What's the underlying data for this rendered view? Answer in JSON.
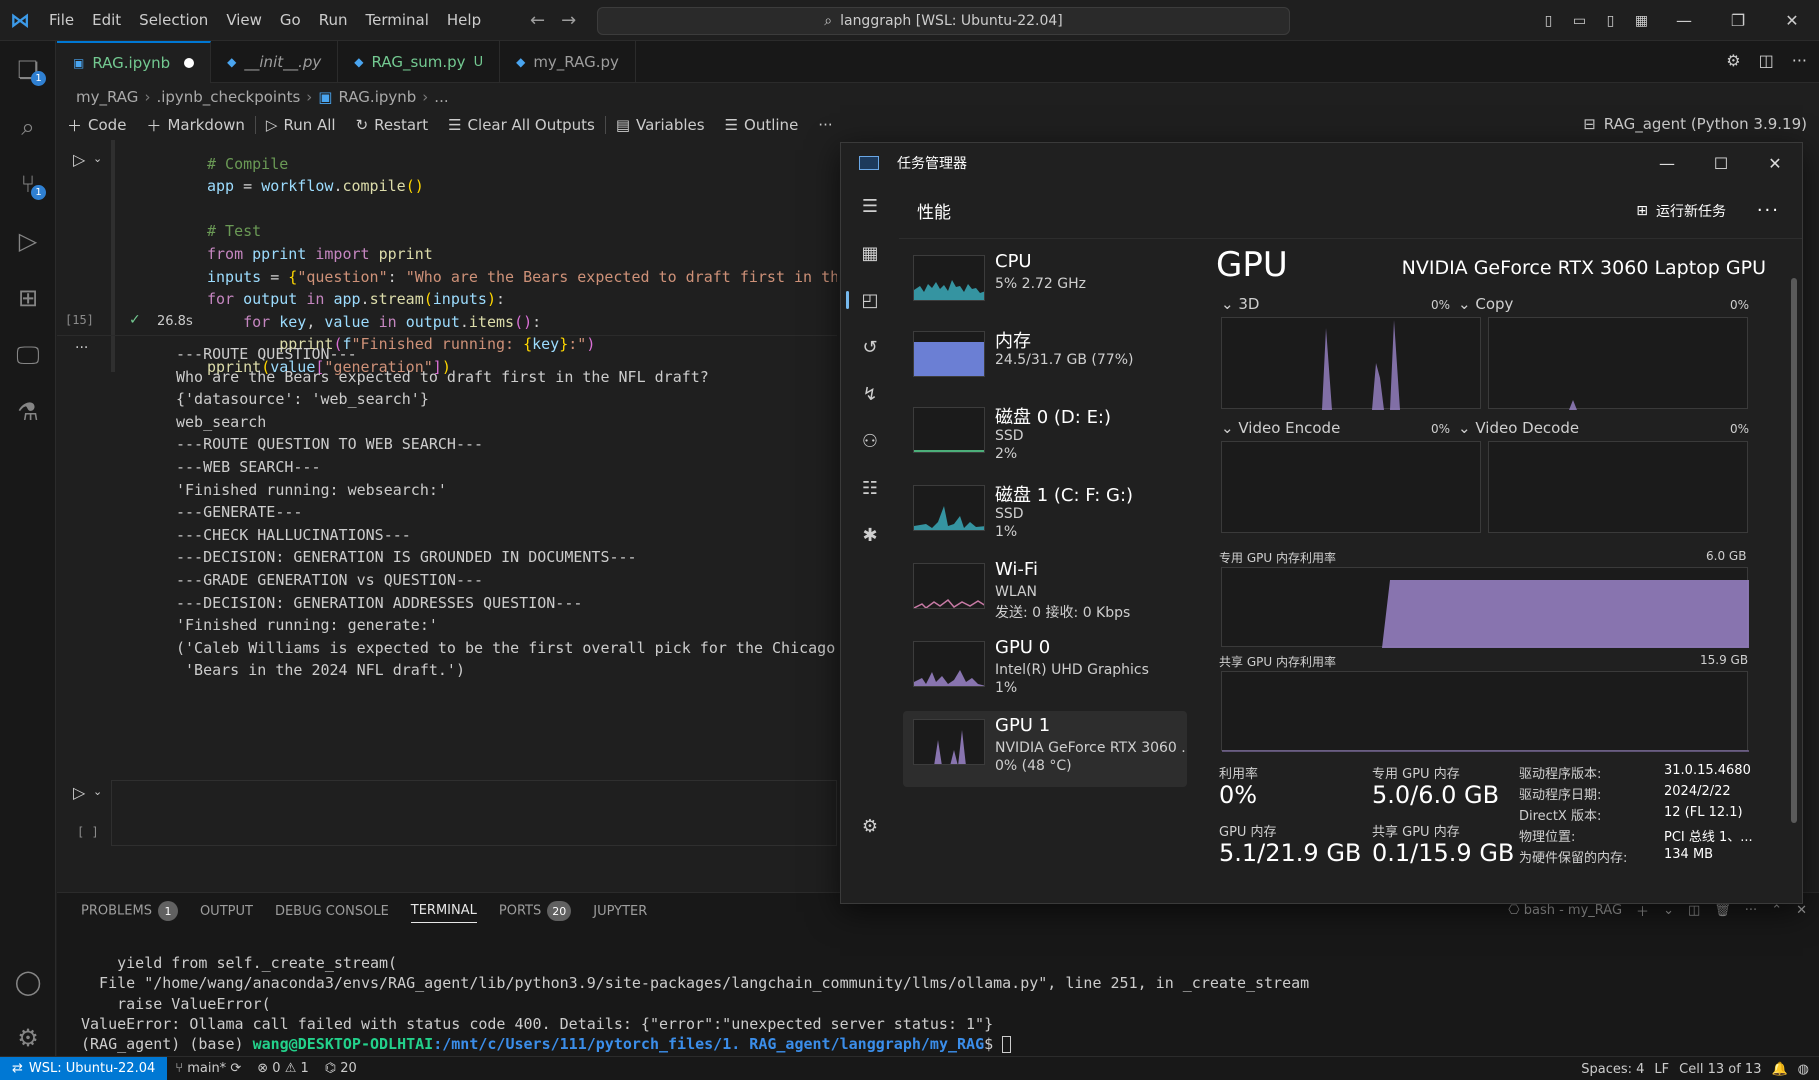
{
  "titlebar": {
    "menu": [
      "File",
      "Edit",
      "Selection",
      "View",
      "Go",
      "Run",
      "Terminal",
      "Help"
    ],
    "command_center": "langgraph [WSL: Ubuntu-22.04]"
  },
  "activity": {
    "explorer_badge": "1",
    "scm_badge": "1"
  },
  "tabs": [
    {
      "label": "RAG.ipynb"
    },
    {
      "label": "__init__.py"
    },
    {
      "label": "RAG_sum.py",
      "status": "U"
    },
    {
      "label": "my_RAG.py"
    }
  ],
  "breadcrumb": [
    "my_RAG",
    ".ipynb_checkpoints",
    "RAG.ipynb",
    "..."
  ],
  "nbtoolbar": {
    "code": "Code",
    "markdown": "Markdown",
    "run_all": "Run All",
    "restart": "Restart",
    "clear": "Clear All Outputs",
    "variables": "Variables",
    "outline": "Outline",
    "more": "···",
    "kernel": "RAG_agent (Python 3.9.19)"
  },
  "cell": {
    "exec_count": "[15]",
    "duration": "26.8s",
    "empty_exec": "[ ]",
    "code_lines": [
      "# Compile",
      "app = workflow.compile()",
      "",
      "# Test",
      "from pprint import pprint",
      "inputs = {\"question\": \"Who are the Bears expected to draft first in the NFL",
      "for output in app.stream(inputs):",
      "    for key, value in output.items():",
      "        pprint(f\"Finished running: {key}:\")",
      "pprint(value[\"generation\"])"
    ],
    "output_lines": [
      "---ROUTE QUESTION---",
      "Who are the Bears expected to draft first in the NFL draft?",
      "{'datasource': 'web_search'}",
      "web_search",
      "---ROUTE QUESTION TO WEB SEARCH---",
      "---WEB SEARCH---",
      "'Finished running: websearch:'",
      "---GENERATE---",
      "---CHECK HALLUCINATIONS---",
      "---DECISION: GENERATION IS GROUNDED IN DOCUMENTS---",
      "---GRADE GENERATION vs QUESTION---",
      "---DECISION: GENERATION ADDRESSES QUESTION---",
      "'Finished running: generate:'",
      "('Caleb Williams is expected to be the first overall pick for the Chicago '",
      " 'Bears in the 2024 NFL draft.')"
    ]
  },
  "panel": {
    "tabs": [
      "PROBLEMS",
      "OUTPUT",
      "DEBUG CONSOLE",
      "TERMINAL",
      "PORTS",
      "JUPYTER"
    ],
    "problems_count": "1",
    "ports_count": "20",
    "terminal_name": "bash - my_RAG",
    "terminal_lines": [
      "    yield from self._create_stream(",
      "  File \"/home/wang/anaconda3/envs/RAG_agent/lib/python3.9/site-packages/langchain_community/llms/ollama.py\", line 251, in _create_stream",
      "    raise ValueError(",
      "ValueError: Ollama call failed with status code 400. Details: {\"error\":\"unexpected server status: 1\"}"
    ],
    "prompt_env": "(RAG_agent) (base) ",
    "prompt_user": "wang@DESKTOP-ODLHTAI",
    "prompt_path": ":/mnt/c/Users/111/pytorch_files/1. RAG_agent/langgraph/my_RAG",
    "prompt_end": "$ "
  },
  "status": {
    "remote": "WSL: Ubuntu-22.04",
    "branch": "main*",
    "errors": "0",
    "warnings": "1",
    "ports": "20",
    "spaces": "Spaces: 4",
    "eol": "LF",
    "cell": "Cell 13 of 13"
  },
  "taskmgr": {
    "title": "任务管理器",
    "section": "性能",
    "run_task": "运行新任务",
    "devices": [
      {
        "name": "CPU",
        "sub1": "5% 2.72 GHz",
        "sub2": ""
      },
      {
        "name": "内存",
        "sub1": "24.5/31.7 GB (77%)",
        "sub2": ""
      },
      {
        "name": "磁盘 0 (D: E:)",
        "sub1": "SSD",
        "sub2": "2%"
      },
      {
        "name": "磁盘 1 (C: F: G:)",
        "sub1": "SSD",
        "sub2": "1%"
      },
      {
        "name": "Wi-Fi",
        "sub1": "WLAN",
        "sub2": "发送: 0 接收: 0 Kbps"
      },
      {
        "name": "GPU 0",
        "sub1": "Intel(R) UHD Graphics",
        "sub2": "1%"
      },
      {
        "name": "GPU 1",
        "sub1": "NVIDIA GeForce RTX 3060 .",
        "sub2": "0% (48 °C)"
      }
    ],
    "gpu": {
      "title": "GPU",
      "model": "NVIDIA GeForce RTX 3060 Laptop GPU",
      "engines": [
        {
          "label": "3D",
          "pct": "0%"
        },
        {
          "label": "Copy",
          "pct": "0%"
        },
        {
          "label": "Video Encode",
          "pct": "0%"
        },
        {
          "label": "Video Decode",
          "pct": "0%"
        }
      ],
      "dedicated_label": "专用 GPU 内存利用率",
      "dedicated_max": "6.0 GB",
      "shared_label": "共享 GPU 内存利用率",
      "shared_max": "15.9 GB",
      "stats": [
        {
          "label": "利用率",
          "value": "0%"
        },
        {
          "label": "专用 GPU 内存",
          "value": "5.0/6.0 GB"
        },
        {
          "label": "GPU 内存",
          "value": "5.1/21.9 GB"
        },
        {
          "label": "共享 GPU 内存",
          "value": "0.1/15.9 GB"
        }
      ],
      "info": [
        {
          "k": "驱动程序版本:",
          "v": "31.0.15.4680"
        },
        {
          "k": "驱动程序日期:",
          "v": "2024/2/22"
        },
        {
          "k": "DirectX 版本:",
          "v": "12 (FL 12.1)"
        },
        {
          "k": "物理位置:",
          "v": "PCI 总线 1、..."
        },
        {
          "k": "为硬件保留的内存:",
          "v": "134 MB"
        }
      ]
    }
  },
  "colors": {
    "accent": "#0078d4",
    "gpu_purple": "#9b84c9",
    "cpu_teal": "#3aa9b8",
    "mem_blue": "#6b7fd4"
  }
}
